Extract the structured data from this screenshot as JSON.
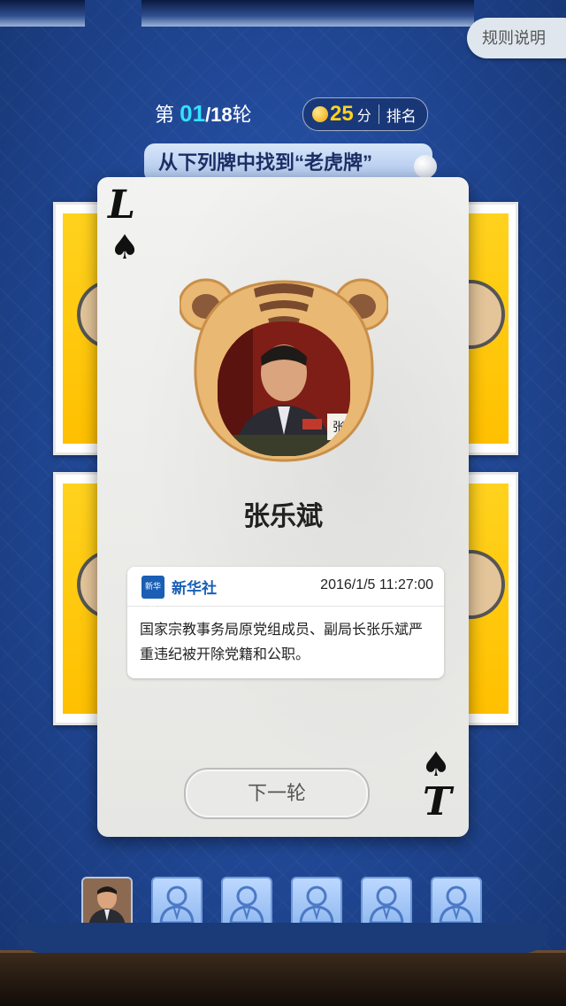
{
  "header": {
    "rules_label": "规则说明",
    "round_prefix": "第",
    "round_current": "01",
    "round_total": "/18",
    "round_suffix": "轮",
    "score_value": "25",
    "score_unit": "分",
    "rank_label": "排名"
  },
  "task": {
    "instruction": "从下列牌中找到“老虎牌”"
  },
  "card": {
    "corner_top_letter": "L",
    "corner_bottom_letter": "T",
    "suit_symbol": "♠",
    "person_name": "张乐斌",
    "badge_char": "张",
    "news": {
      "source_logo": "新华社",
      "source": "新华社",
      "time": "2016/1/5 11:27:00",
      "text": "国家宗教事务局原党组成员、副局长张乐斌严重违纪被开除党籍和公职。"
    },
    "next_button": "下一轮"
  },
  "collection": {
    "slots": [
      "filled",
      "empty",
      "empty",
      "empty",
      "empty",
      "empty"
    ]
  },
  "colors": {
    "accent_cyan": "#33e1ff",
    "score_gold": "#ffd21e",
    "card_yellow": "#ffc000",
    "background_blue": "#224a9a"
  }
}
